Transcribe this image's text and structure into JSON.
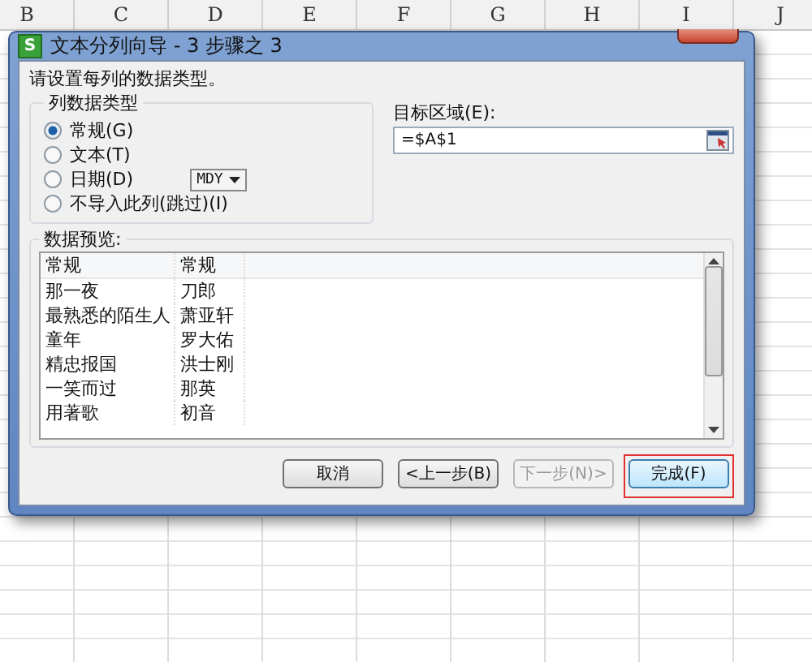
{
  "sheet": {
    "columns": [
      "B",
      "C",
      "D",
      "E",
      "F",
      "G",
      "H",
      "I",
      "J"
    ]
  },
  "window": {
    "app_icon": "S",
    "title": "文本分列向导 - 3 步骤之 3"
  },
  "instruction": "请设置每列的数据类型。",
  "column_type": {
    "title": "列数据类型",
    "options": [
      {
        "label": "常规(G)",
        "selected": true
      },
      {
        "label": "文本(T)",
        "selected": false
      },
      {
        "label": "日期(D)",
        "selected": false,
        "dropdown": "MDY"
      },
      {
        "label": "不导入此列(跳过)(I)",
        "selected": false
      }
    ]
  },
  "destination": {
    "label": "目标区域(E):",
    "value": "=$A$1"
  },
  "preview": {
    "title": "数据预览:",
    "headers": [
      "常规",
      "常规"
    ],
    "rows": [
      [
        "那一夜",
        "刀郎"
      ],
      [
        "最熟悉的陌生人",
        "萧亚轩"
      ],
      [
        "童年",
        "罗大佑"
      ],
      [
        "精忠报国",
        "洪士刚"
      ],
      [
        "一笑而过",
        "那英"
      ],
      [
        "用著歌",
        "初音"
      ]
    ]
  },
  "buttons": [
    {
      "label": "取消",
      "disabled": false,
      "highlighted": false
    },
    {
      "label": "<上一步(B)",
      "disabled": false,
      "highlighted": false
    },
    {
      "label": "下一步(N)>",
      "disabled": true,
      "highlighted": false
    },
    {
      "label": "完成(F)",
      "disabled": false,
      "highlighted": true
    }
  ]
}
